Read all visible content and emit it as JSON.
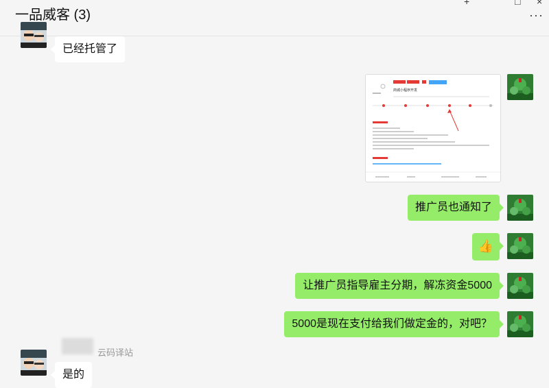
{
  "header": {
    "title": "一品威客 (3)",
    "more_icon": "more-icon",
    "add_icon": "plus-icon",
    "window_icon": "window-icon"
  },
  "messages": [
    {
      "side": "in",
      "text": "已经托管了"
    },
    {
      "side": "out",
      "type": "image",
      "desc": "screenshot-thumbnail"
    },
    {
      "side": "out",
      "text": "推广员也通知了"
    },
    {
      "side": "out",
      "type": "emoji",
      "emoji": "👍"
    },
    {
      "side": "out",
      "text": "让推广员指导雇主分期，解冻资金5000"
    },
    {
      "side": "out",
      "text": "5000是现在支付给我们做定金的，对吧？"
    },
    {
      "side": "in",
      "sender": "云码译站",
      "text": "是的"
    }
  ],
  "screenshot": {
    "project_title": "商城小程序开发"
  },
  "colors": {
    "out_bubble": "#95ec69",
    "in_bubble": "#ffffff",
    "background": "#f5f5f5"
  }
}
